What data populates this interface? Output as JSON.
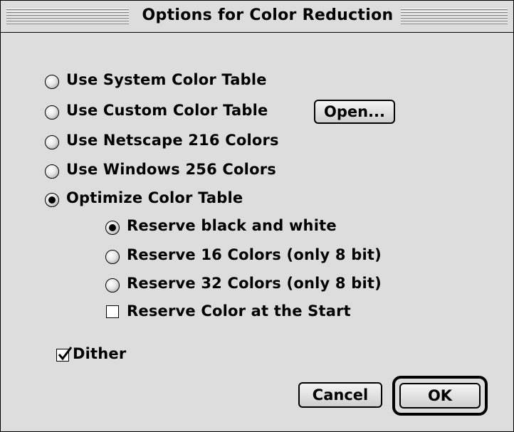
{
  "dialog": {
    "title": "Options for Color Reduction"
  },
  "options": [
    {
      "label": "Use System Color Table",
      "selected": false
    },
    {
      "label": "Use Custom Color Table",
      "selected": false
    },
    {
      "label": "Use Netscape 216 Colors",
      "selected": false
    },
    {
      "label": "Use Windows 256 Colors",
      "selected": false
    },
    {
      "label": "Optimize Color Table",
      "selected": true
    }
  ],
  "sub_options": [
    {
      "label": "Reserve black and white",
      "selected": true
    },
    {
      "label": "Reserve 16 Colors (only 8 bit)",
      "selected": false
    },
    {
      "label": "Reserve 32 Colors (only 8 bit)",
      "selected": false
    }
  ],
  "reserve_start": {
    "label": "Reserve Color at the Start",
    "checked": false
  },
  "dither": {
    "label": "Dither",
    "checked": true
  },
  "buttons": {
    "open": "Open...",
    "cancel": "Cancel",
    "ok": "OK"
  }
}
